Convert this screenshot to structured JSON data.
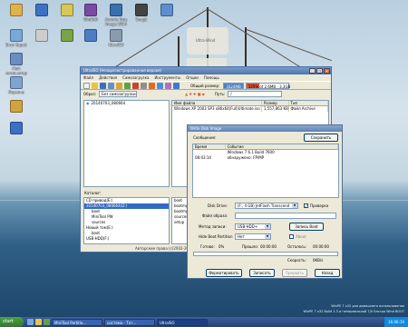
{
  "desktop": {
    "icons": [
      {
        "label": "",
        "color": "#e0b24a"
      },
      {
        "label": "",
        "color": "#3c72c6"
      },
      {
        "label": "",
        "color": "#d8c65a"
      },
      {
        "label": "WinRAR",
        "color": "#7b4aa5"
      },
      {
        "label": "Acronis True Image 2014",
        "color": "#3a6fb0"
      },
      {
        "label": "Snagit",
        "color": "#444444"
      },
      {
        "label": "",
        "color": "#5c8fd0"
      },
      {
        "label": "Error Kapuk",
        "color": "#7aa8d8"
      },
      {
        "label": "",
        "color": "#cccccc"
      },
      {
        "label": "",
        "color": "#7aa444"
      },
      {
        "label": "",
        "color": "#4d7cc4"
      },
      {
        "label": "UltraISO",
        "color": "#8a9bb0"
      },
      {
        "label": "Мой компьютер",
        "color": "#6a8dc4"
      },
      {
        "label": "Корзина",
        "color": "#7fa4d0"
      },
      {
        "label": "",
        "color": "#d2a23c"
      },
      {
        "label": "",
        "color": "#3d6fc6"
      }
    ],
    "ship_name": "Ultra-Wind",
    "watermark_line1": "WinPE 7 x32 для домашнего использования",
    "watermark_line2": "WinPE 7 x32 Build 1.3 и ненормальной 7/0 Ультра Wind BOOT"
  },
  "ultraiso": {
    "title": "UltraISO (Незарегистрированная версия)",
    "menu": [
      "Файл",
      "Действия",
      "Самозагрузка",
      "Инструменты",
      "Опции",
      "Помощь"
    ],
    "image_size_label": "Общий размер:",
    "image_size_value": "3324MB",
    "image_size_extra": "125% of 2.6MB - 3.3GB",
    "image_label": "Образ:",
    "image_value": "Без самозагрузки",
    "path_label": "Путь:",
    "path_value": "/",
    "tree_item": "20140703_080664",
    "file_cols": [
      "Имя файла",
      "Размер",
      "Тип"
    ],
    "file_row": [
      "Windows XP 2003 SP3 x86x64(Full)Ultimate.iso",
      "1,557,863 KB",
      "Файл Archive"
    ],
    "catalog_label": "Каталог:",
    "local_tree": [
      "CD привод(E:)",
      "20140703_080664(D:)",
      "boot",
      "MiniTool PW",
      "sources",
      "Новый том(E:)",
      "boot",
      "USB-HDD(F:)"
    ],
    "local_files": [
      "boot",
      "bootmgr",
      "bootmgr.efi",
      "sources",
      "setup"
    ],
    "status": "Авторские права (c)2002-2014 EZB Systems, Inc."
  },
  "write_dialog": {
    "title": "Write Disk Image",
    "message_label": "Сообщение:",
    "save_label": "Сохранить",
    "col_time": "Время",
    "col_event": "Событие",
    "log": [
      {
        "time": "",
        "event": "Windows 7 6.1 Build 7600"
      },
      {
        "time": "08:03:14",
        "event": "(D:) USB-HDD 4GB"
      }
    ],
    "log_extra": "обнаружено:  FP/MP",
    "disk_drive_label": "Disk Drive:",
    "disk_drive_value": "(F:, 4 GB)     JetFlash Transcend",
    "verify_label": "Проверка",
    "image_file_label": "Файл образа:",
    "image_file_value": "",
    "method_label": "Метод записи:",
    "method_value": "USB-HDD+",
    "hide_boot_label": "Hide Boot Partition",
    "hide_boot_value": "Нет",
    "xboot_label": "Xboot",
    "xboot_partition_label": "Запись Boot",
    "progress_label": "Готово:",
    "progress_value": "0%",
    "elapsed_label": "Прошло:",
    "elapsed_value": "00:00:00",
    "remaining_label": "Осталось:",
    "remaining_value": "00:00:00",
    "speed_label": "Скорость:",
    "speed_value": "0KB/s",
    "buttons": {
      "format": "Форматировать",
      "write": "Записать",
      "abort": "Прервать",
      "back": "Назад"
    }
  },
  "taskbar": {
    "start": "start",
    "tasks": [
      "MiniTool Partitio...",
      "система - Тот...",
      "UltraISO"
    ],
    "clock": "16:06:19"
  }
}
